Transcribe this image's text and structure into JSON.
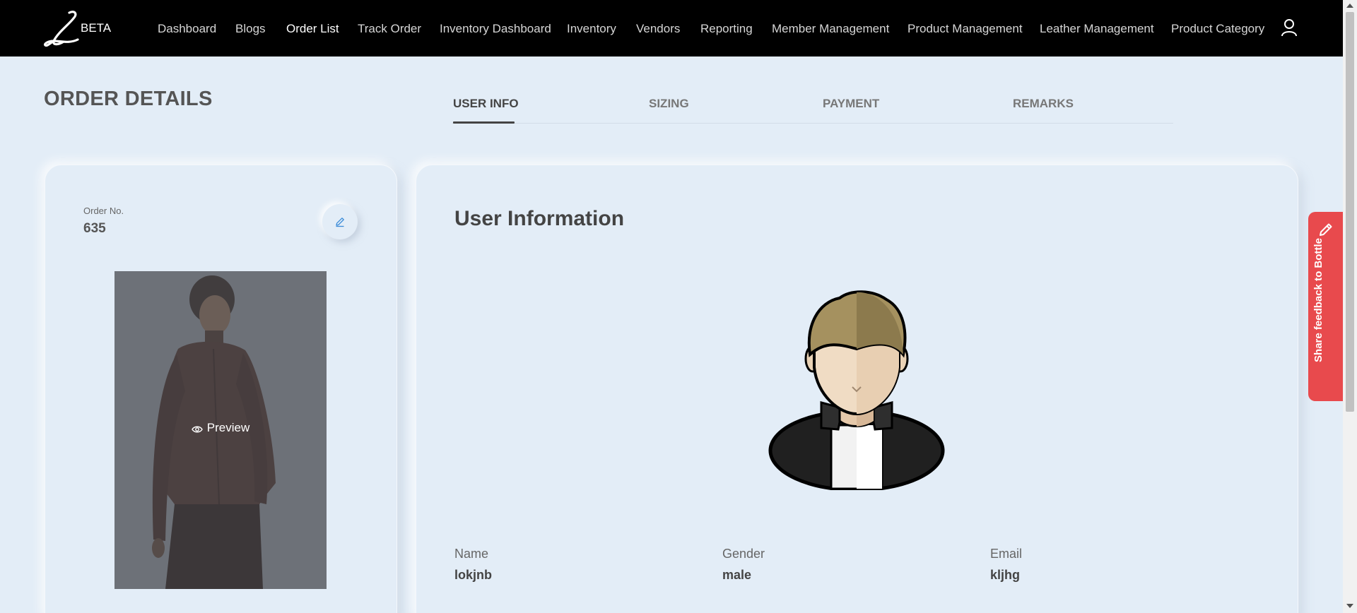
{
  "brand": {
    "logo_letter": "L",
    "badge": "BETA"
  },
  "nav": {
    "items": [
      {
        "label": "Dashboard"
      },
      {
        "label": "Blogs"
      },
      {
        "label": "Order List",
        "active": true
      },
      {
        "label": "Track Order"
      },
      {
        "label": "Inventory Dashboard"
      },
      {
        "label": "Inventory"
      },
      {
        "label": "Vendors"
      },
      {
        "label": "Reporting"
      },
      {
        "label": "Member Management"
      },
      {
        "label": "Product Management"
      },
      {
        "label": "Leather Management"
      },
      {
        "label": "Product Category"
      }
    ],
    "user_icon": "user-icon"
  },
  "page": {
    "title": "ORDER DETAILS"
  },
  "tabs": [
    {
      "label": "USER INFO",
      "active": true
    },
    {
      "label": "SIZING"
    },
    {
      "label": "PAYMENT"
    },
    {
      "label": "REMARKS"
    }
  ],
  "order": {
    "number_label": "Order No.",
    "number": "635",
    "edit_icon": "pencil-icon",
    "preview_label": "Preview",
    "preview_icon": "eye-icon"
  },
  "user_info": {
    "title": "User Information",
    "fields": [
      {
        "label": "Name",
        "value": "lokjnb"
      },
      {
        "label": "Gender",
        "value": "male"
      },
      {
        "label": "Email",
        "value": "kljhg"
      }
    ]
  },
  "feedback": {
    "label": "Share feedback to Bottle",
    "icon": "pencil-icon",
    "color": "#e84a4d"
  }
}
